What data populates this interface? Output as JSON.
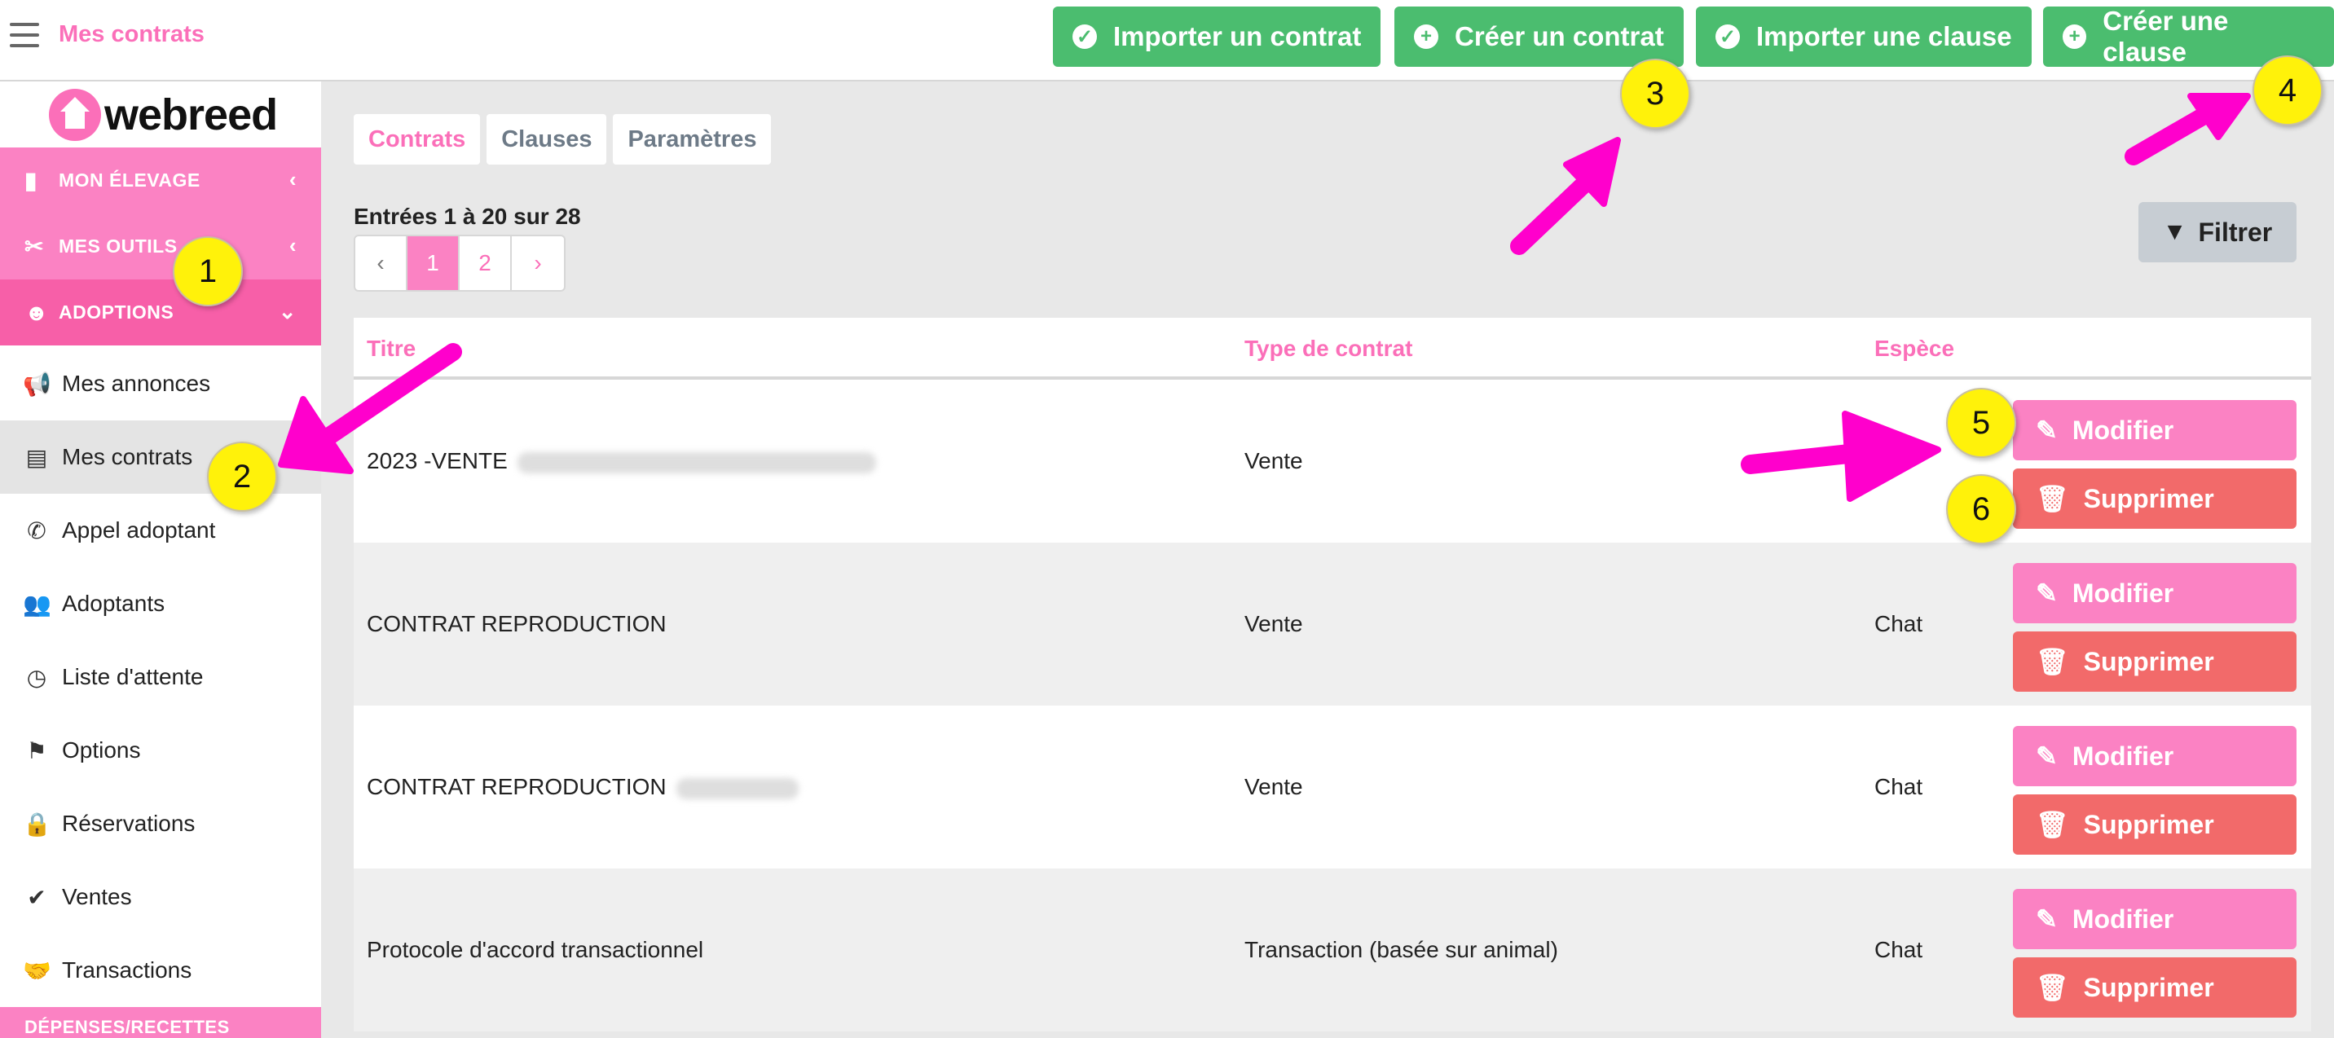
{
  "header": {
    "title": "Mes contrats",
    "buttons": [
      {
        "label": "Importer un contrat",
        "icon": "check-circle-icon"
      },
      {
        "label": "Créer un contrat",
        "icon": "plus-circle-icon"
      },
      {
        "label": "Importer une clause",
        "icon": "check-circle-icon"
      },
      {
        "label": "Créer une clause",
        "icon": "plus-circle-icon"
      }
    ]
  },
  "sidebar": {
    "logo": "webreed",
    "sections": [
      {
        "label": "MON ÉLEVAGE",
        "icon": "bookmark-icon"
      },
      {
        "label": "MES OUTILS",
        "icon": "tools-icon"
      },
      {
        "label": "ADOPTIONS",
        "icon": "smile-icon"
      }
    ],
    "items": [
      {
        "label": "Mes annonces",
        "icon": "megaphone-icon"
      },
      {
        "label": "Mes contrats",
        "icon": "document-icon"
      },
      {
        "label": "Appel adoptant",
        "icon": "phone-icon"
      },
      {
        "label": "Adoptants",
        "icon": "users-icon"
      },
      {
        "label": "Liste d'attente",
        "icon": "clock-icon"
      },
      {
        "label": "Options",
        "icon": "flag-icon"
      },
      {
        "label": "Réservations",
        "icon": "lock-icon"
      },
      {
        "label": "Ventes",
        "icon": "check-icon"
      },
      {
        "label": "Transactions",
        "icon": "handshake-icon"
      }
    ],
    "bottom_section": "DÉPENSES/RECETTES"
  },
  "tabs": [
    "Contrats",
    "Clauses",
    "Paramètres"
  ],
  "entries": "Entrées 1 à 20 sur 28",
  "pagination": {
    "prev": "‹",
    "pages": [
      "1",
      "2"
    ],
    "next": "›",
    "current": "1"
  },
  "filter_label": "Filtrer",
  "table": {
    "columns": [
      "Titre",
      "Type de contrat",
      "Espèce"
    ],
    "rows": [
      {
        "title": "2023 -VENTE",
        "type": "Vente",
        "species": ""
      },
      {
        "title": "CONTRAT REPRODUCTION",
        "type": "Vente",
        "species": "Chat"
      },
      {
        "title": "CONTRAT REPRODUCTION",
        "type": "Vente",
        "species": "Chat"
      },
      {
        "title": "Protocole d'accord transactionnel",
        "type": "Transaction (basée sur animal)",
        "species": "Chat"
      }
    ],
    "edit_label": "Modifier",
    "delete_label": "Supprimer"
  },
  "annotations": [
    "1",
    "2",
    "3",
    "4",
    "5",
    "6"
  ],
  "colors": {
    "pink": "#fb6fb9",
    "green": "#4bbd6f",
    "red": "#f26a6a",
    "annotation_arrow": "#ff00cc",
    "annotation_marker": "#fff20a"
  }
}
